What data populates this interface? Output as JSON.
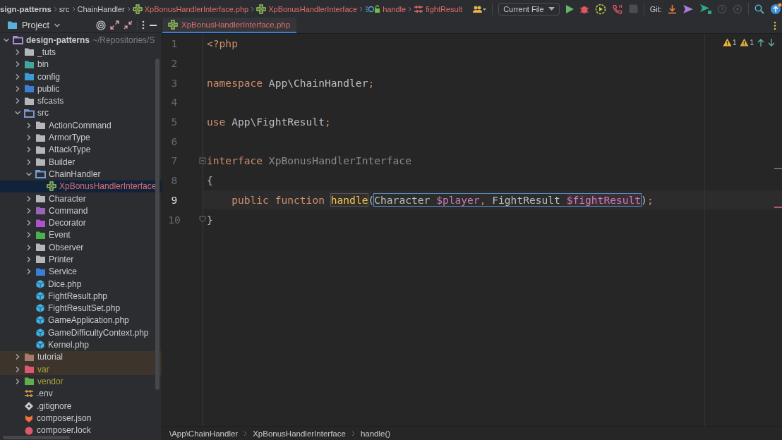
{
  "navbar": {
    "breadcrumbs": [
      {
        "label": "sign-patterns",
        "kind": "project",
        "problem": false
      },
      {
        "label": "src",
        "kind": "folder",
        "problem": false
      },
      {
        "label": "ChainHandler",
        "kind": "folder",
        "problem": false
      },
      {
        "label": "XpBonusHandlerInterface.php",
        "kind": "file",
        "problem": true
      },
      {
        "label": "XpBonusHandlerInterface",
        "kind": "interface",
        "problem": true
      },
      {
        "label": "handle",
        "kind": "method",
        "problem": true
      },
      {
        "label": "fightResult",
        "kind": "parameter",
        "problem": true
      }
    ],
    "run_config": "Current File",
    "git_label": "Git:"
  },
  "project_panel": {
    "title": "Project",
    "tree": [
      {
        "label": "design-patterns",
        "path": "~/Repositories/S",
        "kind": "folder",
        "color": "#a78bd6",
        "expanded": true,
        "selected": false,
        "children": [
          {
            "label": "_tuts",
            "kind": "folder",
            "color": "#b4b6ba",
            "expanded": false,
            "selected": false,
            "ignored": false,
            "excluded": false
          },
          {
            "label": "bin",
            "kind": "folder",
            "color": "#3fa7a0",
            "expanded": false,
            "selected": false,
            "ignored": false,
            "excluded": false
          },
          {
            "label": "config",
            "kind": "folder",
            "color": "#3a9bd5",
            "expanded": false,
            "selected": false,
            "ignored": false,
            "excluded": false
          },
          {
            "label": "public",
            "kind": "folder",
            "color": "#3a7fd5",
            "expanded": false,
            "selected": false,
            "ignored": false,
            "excluded": false
          },
          {
            "label": "sfcasts",
            "kind": "folder",
            "color": "#b4b6ba",
            "expanded": false,
            "selected": false,
            "ignored": false,
            "excluded": false
          },
          {
            "label": "src",
            "kind": "folder",
            "color": "#7f95cf",
            "expanded": true,
            "selected": false,
            "ignored": false,
            "excluded": false,
            "children": [
              {
                "label": "ActionCommand",
                "kind": "folder",
                "color": "#b4b6ba",
                "expanded": false,
                "selected": false,
                "problem": false
              },
              {
                "label": "ArmorType",
                "kind": "folder",
                "color": "#b4b6ba",
                "expanded": false,
                "selected": false,
                "problem": false
              },
              {
                "label": "AttackType",
                "kind": "folder",
                "color": "#b4b6ba",
                "expanded": false,
                "selected": false,
                "problem": false
              },
              {
                "label": "Builder",
                "kind": "folder",
                "color": "#b4b6ba",
                "expanded": false,
                "selected": false,
                "problem": false
              },
              {
                "label": "ChainHandler",
                "kind": "folder",
                "color": "#6f9fd8",
                "expanded": true,
                "selected": false,
                "problem": false,
                "children": [
                  {
                    "label": "XpBonusHandlerInterface",
                    "kind": "interface",
                    "selected": true,
                    "problem": true
                  }
                ]
              },
              {
                "label": "Character",
                "kind": "folder",
                "color": "#b4b6ba",
                "expanded": false,
                "selected": false,
                "problem": false
              },
              {
                "label": "Command",
                "kind": "folder",
                "color": "#9a63b8",
                "expanded": false,
                "selected": false,
                "problem": false
              },
              {
                "label": "Decorator",
                "kind": "folder",
                "color": "#b44fd1",
                "expanded": false,
                "selected": false,
                "problem": false
              },
              {
                "label": "Event",
                "kind": "folder",
                "color": "#4caf50",
                "expanded": false,
                "selected": false,
                "problem": false
              },
              {
                "label": "Observer",
                "kind": "folder",
                "color": "#b4b6ba",
                "expanded": false,
                "selected": false,
                "problem": false
              },
              {
                "label": "Printer",
                "kind": "folder",
                "color": "#b4b6ba",
                "expanded": false,
                "selected": false,
                "problem": false
              },
              {
                "label": "Service",
                "kind": "folder",
                "color": "#3a7fd5",
                "expanded": false,
                "selected": false,
                "problem": false
              },
              {
                "label": "Dice.php",
                "kind": "class",
                "selected": false,
                "problem": false
              },
              {
                "label": "FightResult.php",
                "kind": "class",
                "selected": false,
                "problem": false
              },
              {
                "label": "FightResultSet.php",
                "kind": "class",
                "selected": false,
                "problem": false
              },
              {
                "label": "GameApplication.php",
                "kind": "class",
                "selected": false,
                "problem": false
              },
              {
                "label": "GameDifficultyContext.php",
                "kind": "class",
                "selected": false,
                "problem": false
              },
              {
                "label": "Kernel.php",
                "kind": "class",
                "selected": false,
                "problem": false
              }
            ]
          },
          {
            "label": "tutorial",
            "kind": "folder",
            "color": "#a87a6c",
            "expanded": false,
            "selected": false,
            "ignored": false,
            "excluded": true
          },
          {
            "label": "var",
            "kind": "folder",
            "color": "#e0556f",
            "expanded": false,
            "selected": false,
            "ignored": true,
            "excluded": true
          },
          {
            "label": "vendor",
            "kind": "folder",
            "color": "#5fb04a",
            "expanded": false,
            "selected": false,
            "ignored": true,
            "excluded": false
          },
          {
            "label": ".env",
            "kind": "env",
            "selected": false,
            "ignored": false,
            "excluded": false
          },
          {
            "label": ".gitignore",
            "kind": "git",
            "selected": false,
            "ignored": false,
            "excluded": false
          },
          {
            "label": "composer.json",
            "kind": "composer",
            "selected": false,
            "ignored": false,
            "excluded": false
          },
          {
            "label": "composer.lock",
            "kind": "lock",
            "selected": false,
            "ignored": false,
            "excluded": false
          }
        ]
      }
    ]
  },
  "editor": {
    "tabs": [
      {
        "label": "XpBonusHandlerInterface.php",
        "selected": true,
        "problem": true
      }
    ],
    "inspections": [
      {
        "kind": "warning",
        "count": "1"
      },
      {
        "kind": "weak-warning",
        "count": "1"
      }
    ],
    "lines": [
      {
        "number": "1",
        "current": false,
        "fold_start": false,
        "fold_end": false,
        "tokens": [
          {
            "text": "<?php",
            "kind": "keyword"
          }
        ]
      },
      {
        "number": "2",
        "current": false,
        "fold_start": false,
        "fold_end": false
      },
      {
        "number": "3",
        "current": false,
        "fold_start": false,
        "fold_end": false,
        "tokens": [
          {
            "text": "namespace",
            "kind": "keyword"
          },
          {
            "text": " App\\ChainHandler",
            "kind": "plain"
          },
          {
            "text": ";",
            "kind": "keyword"
          }
        ]
      },
      {
        "number": "4",
        "current": false,
        "fold_start": false,
        "fold_end": false
      },
      {
        "number": "5",
        "current": false,
        "fold_start": false,
        "fold_end": false,
        "tokens": [
          {
            "text": "use",
            "kind": "keyword"
          },
          {
            "text": " App\\FightResult",
            "kind": "plain"
          },
          {
            "text": ";",
            "kind": "keyword"
          }
        ]
      },
      {
        "number": "6",
        "current": false,
        "fold_start": false,
        "fold_end": false
      },
      {
        "number": "7",
        "current": false,
        "fold_start": true,
        "fold_end": false,
        "tokens": [
          {
            "text": "interface",
            "kind": "keyword"
          },
          {
            "text": " XpBonusHandlerInterface",
            "kind": "dim"
          }
        ]
      },
      {
        "number": "8",
        "current": false,
        "fold_start": false,
        "fold_end": false,
        "tokens": [
          {
            "text": "{",
            "kind": "plain"
          }
        ]
      },
      {
        "number": "9",
        "current": true,
        "fold_start": false,
        "fold_end": false,
        "tokens": [
          {
            "text": "    public",
            "kind": "keyword"
          },
          {
            "text": " function ",
            "kind": "keyword"
          },
          {
            "text": "handle",
            "kind": "function-match"
          },
          {
            "text": "(",
            "kind": "plain"
          },
          {
            "kind": "hint-box",
            "tokens": [
              {
                "text": "Character ",
                "kind": "plain"
              },
              {
                "text": "$player",
                "kind": "variable"
              },
              {
                "text": ", ",
                "kind": "keyword"
              },
              {
                "text": "FightResult ",
                "kind": "plain"
              },
              {
                "text": "$fightResult",
                "kind": "variable-match"
              }
            ]
          },
          {
            "text": ")",
            "kind": "plain"
          },
          {
            "text": ";",
            "kind": "keyword"
          }
        ]
      },
      {
        "number": "10",
        "current": false,
        "fold_start": false,
        "fold_end": true,
        "tokens": [
          {
            "text": "}",
            "kind": "plain"
          }
        ]
      }
    ]
  },
  "status_bar": {
    "breadcrumbs": [
      "\\App\\ChainHandler",
      "XpBonusHandlerInterface",
      "handle()"
    ]
  }
}
